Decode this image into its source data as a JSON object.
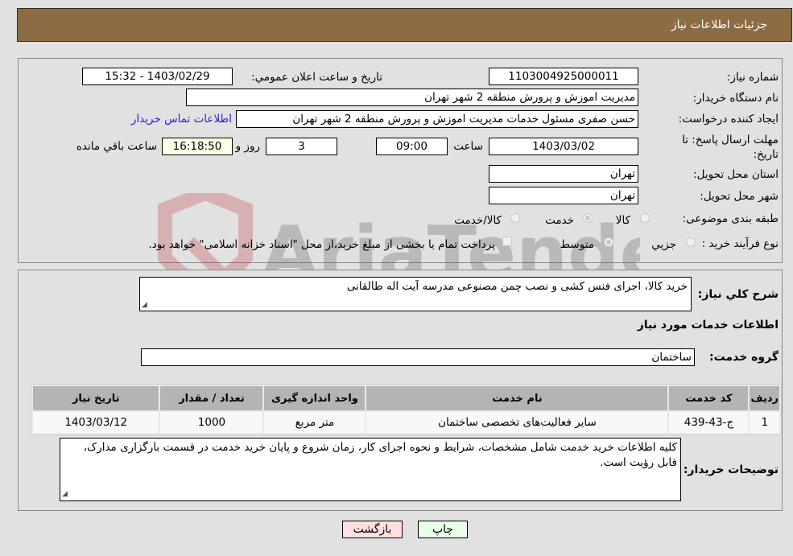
{
  "header": {
    "title": "جزئیات اطلاعات نیاز"
  },
  "fields": {
    "need_number": {
      "label": "شماره نیاز:",
      "value": "1103004925000011"
    },
    "announce_datetime": {
      "label": "تاریخ و ساعت اعلان عمومي:",
      "value": "1403/02/29 - 15:32"
    },
    "buyer_org": {
      "label": "نام دستگاه خريدار:",
      "value": "مدیریت اموزش و پرورش منطقه 2 شهر تهران"
    },
    "requester": {
      "label": "ایجاد کننده درخواست:",
      "value": "حسن صفری مسئول خدمات مدیریت اموزش و پرورش منطقه 2 شهر تهران"
    },
    "buyer_contact_link": "اطلاعات تماس خریدار",
    "deadline": {
      "label": "مهلت ارسال پاسخ: تا تاریخ:",
      "date": "1403/03/02",
      "time_label": "ساعت",
      "time": "09:00",
      "days": "3",
      "days_label": "روز و",
      "remaining": "16:18:50",
      "remaining_label": "ساعت باقي مانده"
    },
    "province": {
      "label": "استان محل تحویل:",
      "value": "تهران"
    },
    "city": {
      "label": "شهر محل تحویل:",
      "value": "تهران"
    },
    "category": {
      "label": "طبقه بندی موضوعی:",
      "options": [
        "کالا",
        "خدمت",
        "کالا/خدمت"
      ],
      "selected": "خدمت"
    },
    "purchase_process": {
      "label": "نوع فرآیند خرید :",
      "options": [
        "جزيي",
        "متوسط"
      ],
      "selected": "متوسط",
      "treasury_note": "پرداخت تمام یا بخشی از مبلغ خرید،از محل \"اسناد خزانه اسلامی\" خواهد بود.",
      "treasury_checked": false
    }
  },
  "summary": {
    "label": "شرح کلي نياز:",
    "value": "خرید کالا، اجرای فنس کشی و نصب چمن مصنوعی مدرسه آیت اله طالقانی"
  },
  "services_section_title": "اطلاعات خدمات مورد نياز",
  "service_group": {
    "label": "گروه خدمت:",
    "value": "ساختمان"
  },
  "table": {
    "headers": [
      "رديف",
      "کد خدمت",
      "نام خدمت",
      "واحد اندازه گیری",
      "تعداد / مقدار",
      "تاریخ نیاز"
    ],
    "rows": [
      [
        "1",
        "ج-43-439",
        "سایر فعالیت‌های تخصصی ساختمان",
        "متر مربع",
        "1000",
        "1403/03/12"
      ]
    ]
  },
  "buyer_notes": {
    "label": "توضيحات خريدار:",
    "value": "کلیه اطلاعات خرید خدمت شامل مشخصات، شرایط و نحوه اجرای کار، زمان شروع و پایان خرید خدمت در قسمت بارگزاری مدارک، قابل رؤیت است."
  },
  "buttons": {
    "print": "چاپ",
    "back": "بازگشت"
  },
  "colors": {
    "header_bg": "#8c6c44",
    "back_btn_bg": "#ffe0e0",
    "print_btn_bg": "#e8ffe8",
    "link": "#2424d8"
  }
}
